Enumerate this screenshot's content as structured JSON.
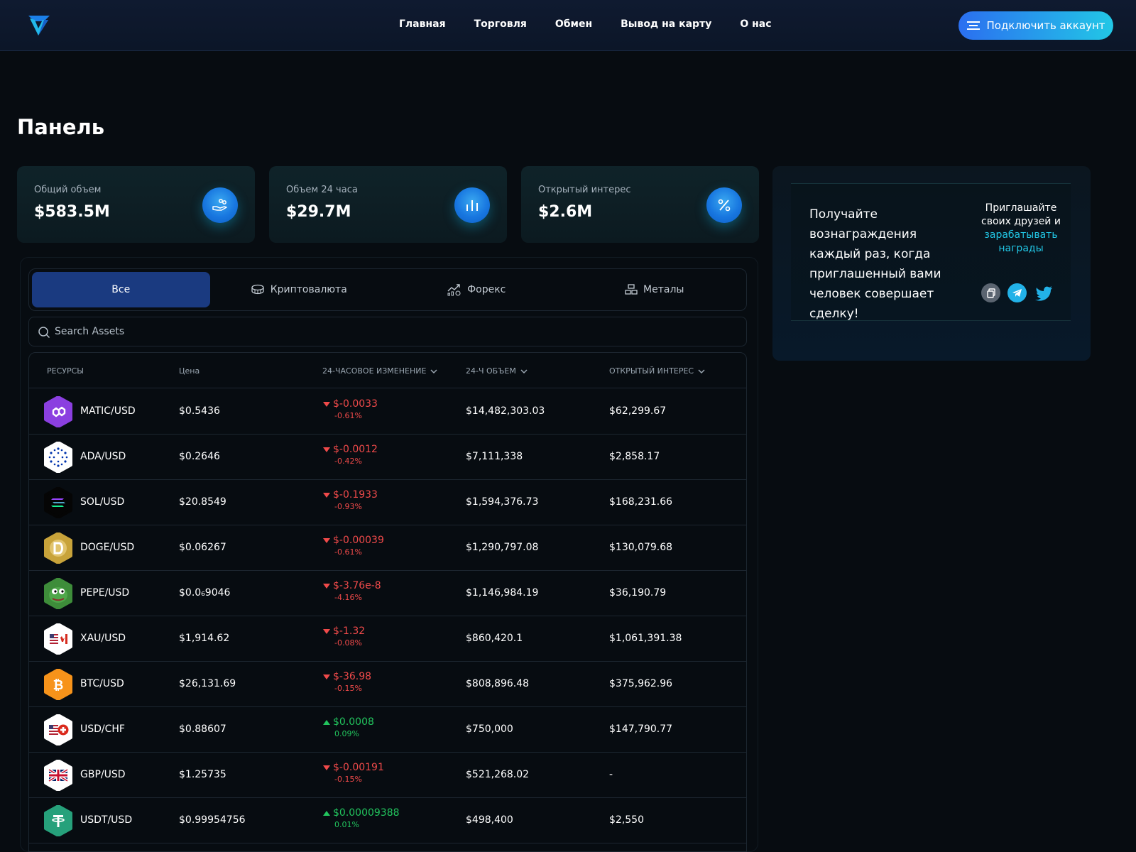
{
  "nav": {
    "items": [
      "Главная",
      "Торговля",
      "Обмен",
      "Вывод на карту",
      "О нас"
    ],
    "connect_label": "Подключить аккаунт"
  },
  "page_title": "Панель",
  "stats": [
    {
      "label": "Общий объем",
      "value": "$583.5M",
      "icon": "hand-coins-icon"
    },
    {
      "label": "Объем 24 часа",
      "value": "$29.7M",
      "icon": "bar-chart-icon"
    },
    {
      "label": "Открытый интерес",
      "value": "$2.6M",
      "icon": "percent-icon"
    }
  ],
  "referral": {
    "text": "Получайте вознаграждения каждый раз, когда приглашенный вами человек совершает сделку!",
    "side_line1": "Приглашайте своих друзей и",
    "side_highlight": "зарабатывать награды"
  },
  "tabs": [
    {
      "label": "Все",
      "active": true
    },
    {
      "label": "Криптовалюта",
      "icon": "coins-icon"
    },
    {
      "label": "Форекс",
      "icon": "trend-chart-icon"
    },
    {
      "label": "Металы",
      "icon": "bars-stack-icon"
    }
  ],
  "search": {
    "placeholder": "Search Assets"
  },
  "table": {
    "headers": [
      "РЕСУРСЫ",
      "Цена",
      "24-ЧАСОВОЕ ИЗМЕНЕНИЕ",
      "24-Ч ОБЪЕМ",
      "ОТКРЫТЫЙ ИНТЕРЕС"
    ],
    "rows": [
      {
        "name": "MATIC/USD",
        "price": "$0.5436",
        "change": "$-0.0033",
        "pct": "-0.61%",
        "dir": "down",
        "volume": "$14,482,303.03",
        "oi": "$62,299.67"
      },
      {
        "name": "ADA/USD",
        "price": "$0.2646",
        "change": "$-0.0012",
        "pct": "-0.42%",
        "dir": "down",
        "volume": "$7,111,338",
        "oi": "$2,858.17"
      },
      {
        "name": "SOL/USD",
        "price": "$20.8549",
        "change": "$-0.1933",
        "pct": "-0.93%",
        "dir": "down",
        "volume": "$1,594,376.73",
        "oi": "$168,231.66"
      },
      {
        "name": "DOGE/USD",
        "price": "$0.06267",
        "change": "$-0.00039",
        "pct": "-0.61%",
        "dir": "down",
        "volume": "$1,290,797.08",
        "oi": "$130,079.68"
      },
      {
        "name": "PEPE/USD",
        "price": "$0.0₆9046",
        "change": "$-3.76e-8",
        "pct": "-4.16%",
        "dir": "down",
        "volume": "$1,146,984.19",
        "oi": "$36,190.79"
      },
      {
        "name": "XAU/USD",
        "price": "$1,914.62",
        "change": "$-1.32",
        "pct": "-0.08%",
        "dir": "down",
        "volume": "$860,420.1",
        "oi": "$1,061,391.38"
      },
      {
        "name": "BTC/USD",
        "price": "$26,131.69",
        "change": "$-36.98",
        "pct": "-0.15%",
        "dir": "down",
        "volume": "$808,896.48",
        "oi": "$375,962.96"
      },
      {
        "name": "USD/CHF",
        "price": "$0.88607",
        "change": "$0.0008",
        "pct": "0.09%",
        "dir": "up",
        "volume": "$750,000",
        "oi": "$147,790.77"
      },
      {
        "name": "GBP/USD",
        "price": "$1.25735",
        "change": "$-0.00191",
        "pct": "-0.15%",
        "dir": "down",
        "volume": "$521,268.02",
        "oi": "-"
      },
      {
        "name": "USDT/USD",
        "price": "$0.99954756",
        "change": "$0.00009388",
        "pct": "0.01%",
        "dir": "up",
        "volume": "$498,400",
        "oi": "$2,550"
      }
    ]
  },
  "colors": {
    "accent": "#22c7e6",
    "negative": "#f04a4a",
    "positive": "#22c55e",
    "tab_active": "#1a3a80"
  }
}
